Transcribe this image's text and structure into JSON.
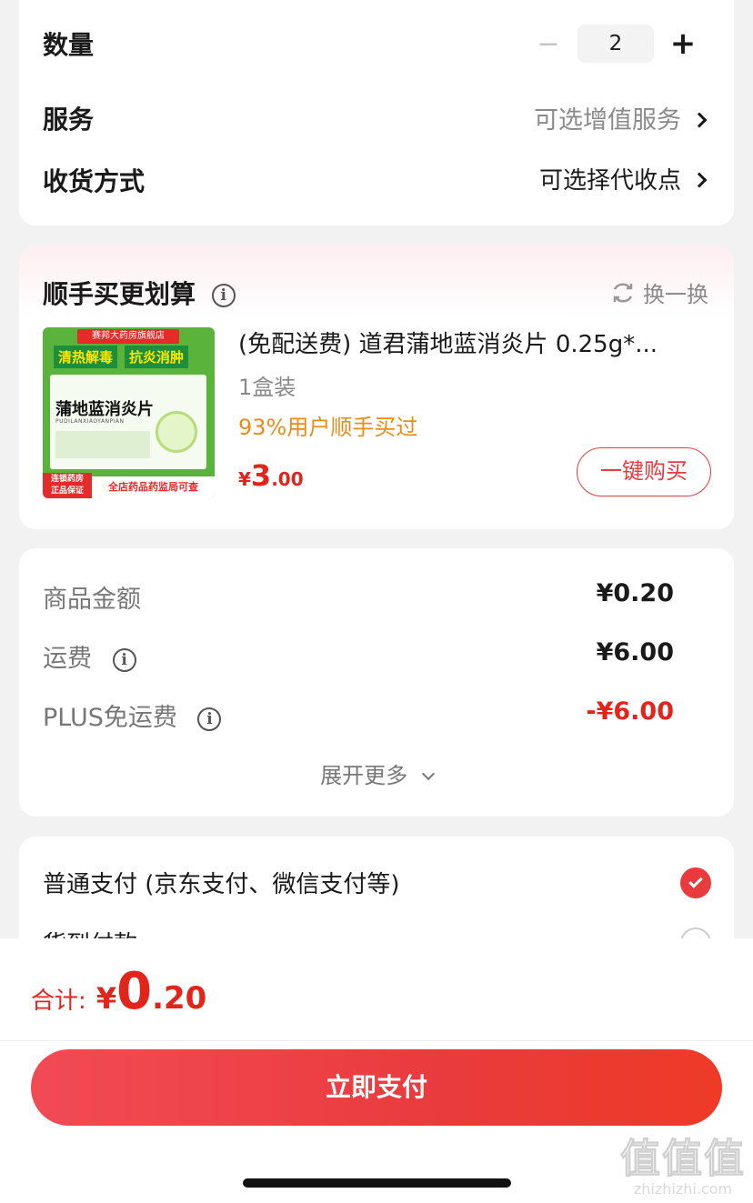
{
  "order": {
    "quantity_label": "数量",
    "quantity_value": "2",
    "minus_glyph": "−",
    "plus_glyph": "+",
    "service_label": "服务",
    "service_value": "可选增值服务",
    "delivery_label": "收货方式",
    "delivery_value": "可选择代收点"
  },
  "addon": {
    "title": "顺手买更划算",
    "refresh_label": "换一换",
    "product_title": "(免配送费) 道君蒲地蓝消炎片 0.25g*...",
    "spec": "1盒装",
    "social_proof": "93%用户顺手买过",
    "price_symbol": "¥",
    "price_int": "3",
    "price_dec": ".00",
    "buy_button": "一键购买",
    "image": {
      "store_banner": "赛邦大药房旗舰店",
      "slogan_left": "清热解毒",
      "slogan_right": "抗炎消肿",
      "drug_name": "蒲地蓝消炎片",
      "drug_pinyin": "PUDILANXIAOYANPIAN",
      "badge_line1": "连锁药房",
      "badge_line2": "正品保证",
      "bottom_text": "全店药品药监局可查"
    }
  },
  "fees": {
    "goods_label": "商品金额",
    "goods_value": "¥0.20",
    "shipping_label": "运费",
    "shipping_value": "¥6.00",
    "plus_label": "PLUS免运费",
    "plus_value": "-¥6.00",
    "expand_label": "展开更多"
  },
  "payment": {
    "option1": "普通支付 (京东支付、微信支付等)",
    "option2": "货到付款"
  },
  "footer": {
    "total_label": "合计:",
    "total_symbol": "¥",
    "total_int": "0",
    "total_dec": ".20",
    "pay_button": "立即支付"
  },
  "watermark": {
    "logo_text": "值值值",
    "domain": "zhizhizhi.com"
  },
  "colors": {
    "accent_red": "#e93b3d",
    "orange": "#ea8c1a",
    "price_red": "#e1251b"
  }
}
